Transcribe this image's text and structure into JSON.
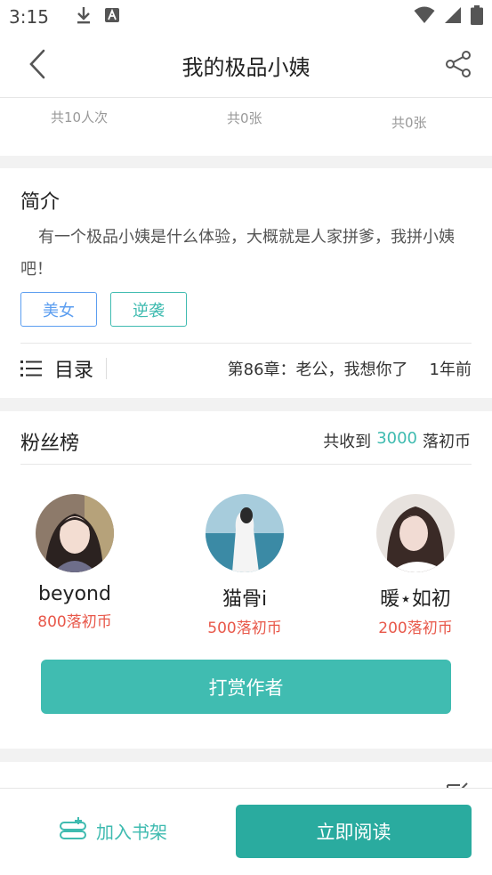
{
  "status_bar": {
    "time": "3:15"
  },
  "header": {
    "title": "我的极品小姨"
  },
  "stats": [
    {
      "label": "共10人次"
    },
    {
      "label": "共0张"
    },
    {
      "label": "共0张"
    }
  ],
  "intro": {
    "title": "简介",
    "text": "有一个极品小姨是什么体验，大概就是人家拼爹，我拼小姨吧！",
    "tags": [
      "美女",
      "逆袭"
    ]
  },
  "toc": {
    "label": "目录",
    "latest_chapter": "第86章：老公，我想你了",
    "updated": "1年前"
  },
  "fans": {
    "title": "粉丝榜",
    "summary_prefix": "共收到",
    "total": "3000",
    "currency": "落初币",
    "ranking": [
      {
        "name": "beyond",
        "coins": "800落初币"
      },
      {
        "name": "猫骨i",
        "coins": "500落初币"
      },
      {
        "name": "暖⋆如初",
        "coins": "200落初币"
      }
    ],
    "reward_label": "打赏作者"
  },
  "bottom_bar": {
    "add_shelf_label": "加入书架",
    "read_label": "立即阅读"
  },
  "colors": {
    "accent": "#40bcb1",
    "read_button": "#2aab9f",
    "coins": "#e8584a",
    "tag_blue": "#5c9ef0"
  }
}
